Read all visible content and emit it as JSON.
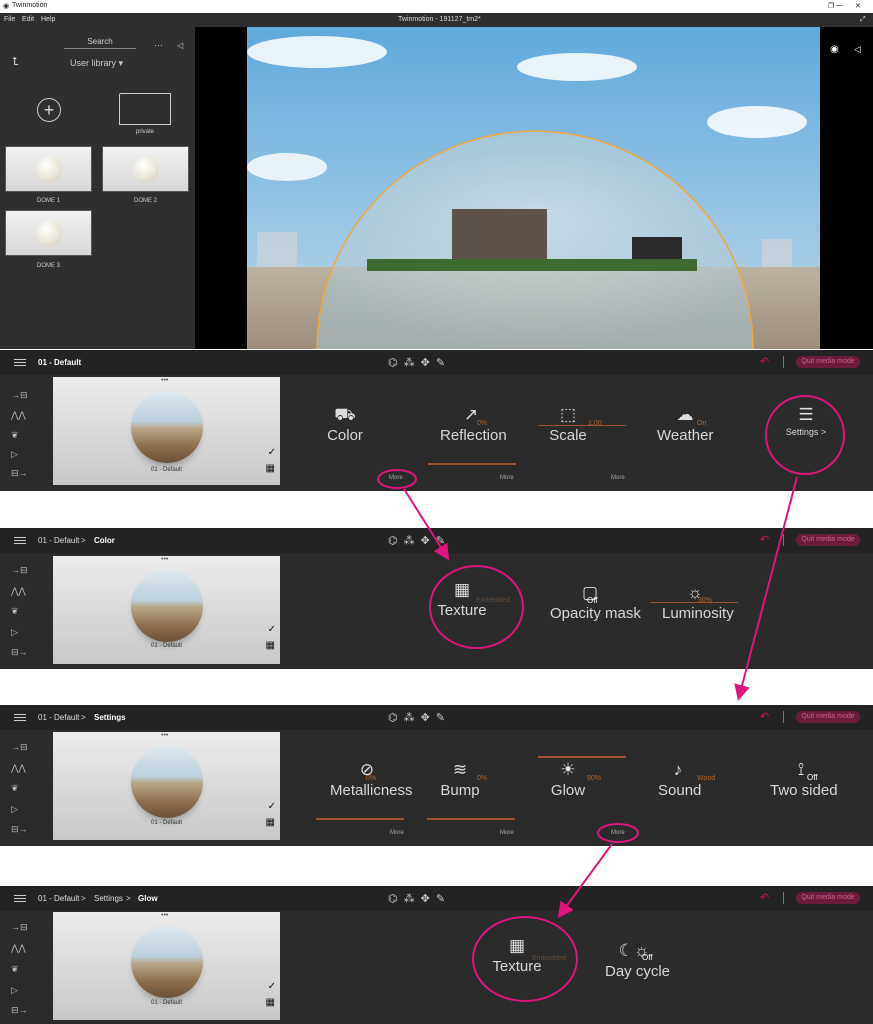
{
  "app": {
    "name": "Twinmotion",
    "doc_title": "Twinmotion - 191127_tm2*",
    "menu": [
      "File",
      "Edit",
      "Help"
    ],
    "win_controls": [
      "—",
      "❐",
      "✕"
    ]
  },
  "library": {
    "search_label": "Search",
    "dropdown_label": "User library",
    "folder_label": "private",
    "items": [
      "DOME 1",
      "DOME 2",
      "DOME 3"
    ]
  },
  "panel1": {
    "crumbs": [
      "01 - Default"
    ],
    "material_name": "01 - Default",
    "quit_label": "Quit media mode",
    "props": [
      {
        "name": "Color",
        "value": "",
        "more": "More"
      },
      {
        "name": "Reflection",
        "value": "0%",
        "more": "More"
      },
      {
        "name": "Scale",
        "value": "1.00",
        "more": "More"
      },
      {
        "name": "Weather",
        "value": "On"
      },
      {
        "name": "Settings",
        "chevron": ">"
      }
    ]
  },
  "panel2": {
    "crumbs": [
      "01 - Default",
      "Color"
    ],
    "material_name": "01 - Default",
    "quit_label": "Quit media mode",
    "props": [
      {
        "name": "Texture",
        "value": "Embedded"
      },
      {
        "name": "Opacity mask",
        "value": "Off"
      },
      {
        "name": "Luminosity",
        "value": "50%"
      }
    ]
  },
  "panel3": {
    "crumbs": [
      "01 - Default",
      "Settings"
    ],
    "material_name": "01 - Default",
    "quit_label": "Quit media mode",
    "props": [
      {
        "name": "Metallicness",
        "value": "0%",
        "more": "More"
      },
      {
        "name": "Bump",
        "value": "0%",
        "more": "More"
      },
      {
        "name": "Glow",
        "value": "90%",
        "more": "More"
      },
      {
        "name": "Sound",
        "value": "Wood"
      },
      {
        "name": "Two sided",
        "value": "Off"
      }
    ]
  },
  "panel4": {
    "crumbs": [
      "01 - Default",
      "Settings",
      "Glow"
    ],
    "material_name": "01 - Default",
    "quit_label": "Quit media mode",
    "props": [
      {
        "name": "Texture",
        "value": "Embedded"
      },
      {
        "name": "Day cycle",
        "value": "Off"
      }
    ]
  },
  "colors": {
    "accent": "#e0147f",
    "value_orange": "#b5652a",
    "bg_dark": "#2b2b2b"
  }
}
